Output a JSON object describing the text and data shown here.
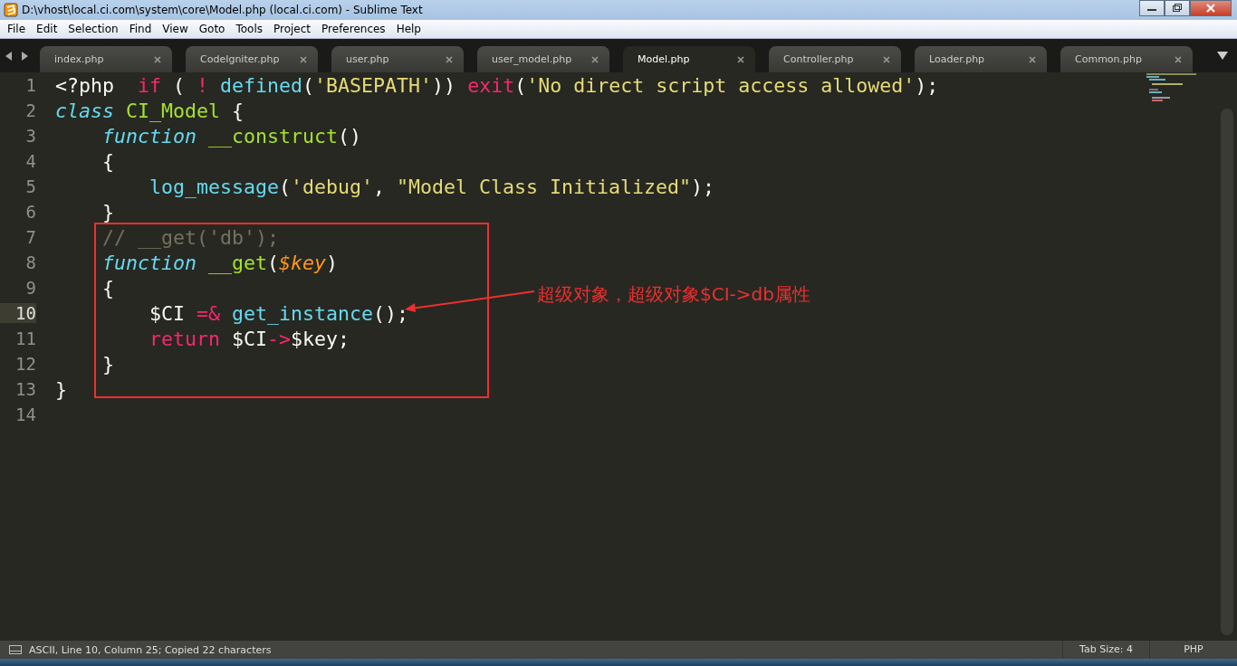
{
  "window": {
    "title": "D:\\vhost\\local.ci.com\\system\\core\\Model.php (local.ci.com) - Sublime Text"
  },
  "menu": [
    "File",
    "Edit",
    "Selection",
    "Find",
    "View",
    "Goto",
    "Tools",
    "Project",
    "Preferences",
    "Help"
  ],
  "tabs": [
    {
      "label": "index.php",
      "selected": false
    },
    {
      "label": "CodeIgniter.php",
      "selected": false
    },
    {
      "label": "user.php",
      "selected": false
    },
    {
      "label": "user_model.php",
      "selected": false
    },
    {
      "label": "Model.php",
      "selected": true
    },
    {
      "label": "Controller.php",
      "selected": false
    },
    {
      "label": "Loader.php",
      "selected": false
    },
    {
      "label": "Common.php",
      "selected": false
    }
  ],
  "lines": [
    {
      "number": "1",
      "current": false,
      "tokens": [
        {
          "text": "<?php  ",
          "kind": "plain"
        },
        {
          "text": "if",
          "kind": "keyword"
        },
        {
          "text": " ( ",
          "kind": "plain"
        },
        {
          "text": "!",
          "kind": "keyword"
        },
        {
          "text": " defined",
          "kind": "support"
        },
        {
          "text": "(",
          "kind": "plain"
        },
        {
          "text": "'BASEPATH'",
          "kind": "string"
        },
        {
          "text": ")) ",
          "kind": "plain"
        },
        {
          "text": "exit",
          "kind": "keyword"
        },
        {
          "text": "(",
          "kind": "plain"
        },
        {
          "text": "'No direct script access allowed'",
          "kind": "string"
        },
        {
          "text": ");",
          "kind": "plain"
        }
      ]
    },
    {
      "number": "2",
      "current": false,
      "tokens": [
        {
          "text": "class",
          "kind": "storage"
        },
        {
          "text": " CI_Model",
          "kind": "name"
        },
        {
          "text": " {",
          "kind": "plain"
        }
      ]
    },
    {
      "number": "3",
      "current": false,
      "tokens": [
        {
          "text": "    function",
          "kind": "storage"
        },
        {
          "text": " __construct",
          "kind": "name"
        },
        {
          "text": "()",
          "kind": "plain"
        }
      ]
    },
    {
      "number": "4",
      "current": false,
      "tokens": [
        {
          "text": "    {",
          "kind": "plain"
        }
      ]
    },
    {
      "number": "5",
      "current": false,
      "tokens": [
        {
          "text": "        log_message",
          "kind": "support"
        },
        {
          "text": "(",
          "kind": "plain"
        },
        {
          "text": "'debug'",
          "kind": "string"
        },
        {
          "text": ", ",
          "kind": "plain"
        },
        {
          "text": "\"Model Class Initialized\"",
          "kind": "string"
        },
        {
          "text": ");",
          "kind": "plain"
        }
      ]
    },
    {
      "number": "6",
      "current": false,
      "tokens": [
        {
          "text": "    }",
          "kind": "plain"
        }
      ]
    },
    {
      "number": "7",
      "current": false,
      "tokens": [
        {
          "text": "    // __get('db');",
          "kind": "comment"
        }
      ]
    },
    {
      "number": "8",
      "current": false,
      "tokens": [
        {
          "text": "    function",
          "kind": "storage"
        },
        {
          "text": " __get",
          "kind": "name"
        },
        {
          "text": "(",
          "kind": "plain"
        },
        {
          "text": "$key",
          "kind": "param"
        },
        {
          "text": ")",
          "kind": "plain"
        }
      ]
    },
    {
      "number": "9",
      "current": false,
      "tokens": [
        {
          "text": "    {",
          "kind": "plain"
        }
      ]
    },
    {
      "number": "10",
      "current": true,
      "tokens": [
        {
          "text": "        $CI ",
          "kind": "plain"
        },
        {
          "text": "=&",
          "kind": "keyword"
        },
        {
          "text": " get_instance",
          "kind": "support"
        },
        {
          "text": "();",
          "kind": "plain"
        }
      ]
    },
    {
      "number": "11",
      "current": false,
      "tokens": [
        {
          "text": "        return",
          "kind": "keyword"
        },
        {
          "text": " $CI",
          "kind": "plain"
        },
        {
          "text": "->",
          "kind": "keyword"
        },
        {
          "text": "$key;",
          "kind": "plain"
        }
      ]
    },
    {
      "number": "12",
      "current": false,
      "tokens": [
        {
          "text": "    }",
          "kind": "plain"
        }
      ]
    },
    {
      "number": "13",
      "current": false,
      "tokens": [
        {
          "text": "}",
          "kind": "plain"
        }
      ]
    },
    {
      "number": "14",
      "current": false
    }
  ],
  "annotation": {
    "text": "超级对象，超级对象$CI->db属性"
  },
  "status_bar": {
    "message": "ASCII, Line 10, Column 25; Copied 22 characters",
    "tab_size": "Tab Size: 4",
    "syntax": "PHP"
  }
}
